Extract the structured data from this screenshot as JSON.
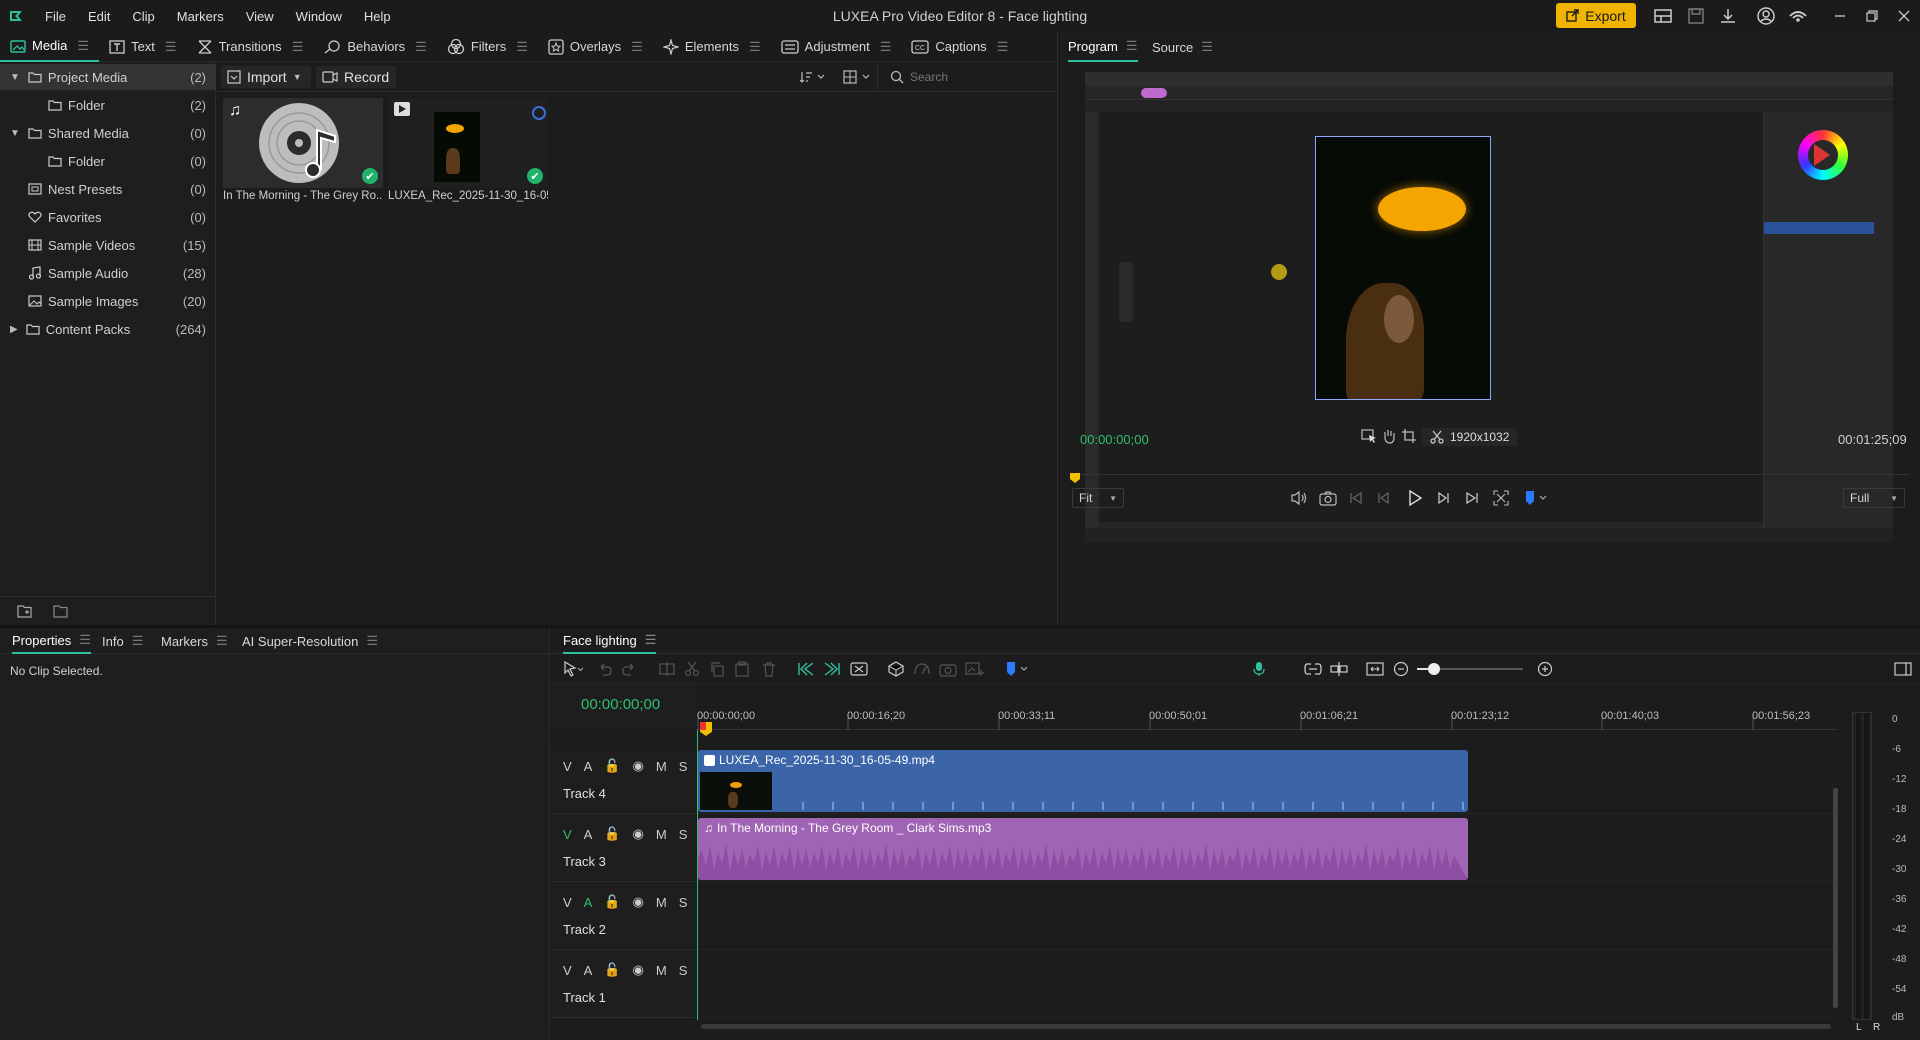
{
  "app": {
    "title": "LUXEA Pro Video Editor 8 - Face lighting",
    "menu": [
      "File",
      "Edit",
      "Clip",
      "Markers",
      "View",
      "Window",
      "Help"
    ],
    "export_label": "Export"
  },
  "tooltabs": [
    {
      "label": "Media",
      "icon": "media-icon"
    },
    {
      "label": "Text",
      "icon": "text-icon"
    },
    {
      "label": "Transitions",
      "icon": "transitions-icon"
    },
    {
      "label": "Behaviors",
      "icon": "behaviors-icon"
    },
    {
      "label": "Filters",
      "icon": "filters-icon"
    },
    {
      "label": "Overlays",
      "icon": "overlays-icon"
    },
    {
      "label": "Elements",
      "icon": "elements-icon"
    },
    {
      "label": "Adjustment",
      "icon": "adjustment-icon"
    },
    {
      "label": "Captions",
      "icon": "captions-icon"
    }
  ],
  "media_tree": [
    {
      "label": "Project Media",
      "count": "(2)"
    },
    {
      "label": "Folder",
      "count": "(2)"
    },
    {
      "label": "Shared Media",
      "count": "(0)"
    },
    {
      "label": "Folder",
      "count": "(0)"
    },
    {
      "label": "Nest Presets",
      "count": "(0)"
    },
    {
      "label": "Favorites",
      "count": "(0)"
    },
    {
      "label": "Sample Videos",
      "count": "(15)"
    },
    {
      "label": "Sample Audio",
      "count": "(28)"
    },
    {
      "label": "Sample Images",
      "count": "(20)"
    },
    {
      "label": "Content Packs",
      "count": "(264)"
    }
  ],
  "bin": {
    "import_label": "Import",
    "record_label": "Record",
    "search_placeholder": "Search",
    "items": [
      {
        "label": "In The Morning - The Grey Ro..."
      },
      {
        "label": "LUXEA_Rec_2025-11-30_16-05..."
      }
    ]
  },
  "program": {
    "tabs": [
      "Program",
      "Source"
    ],
    "current_tc": "00:00:00;00",
    "duration_tc": "00:01:25;09",
    "resolution": "1920x1032",
    "fit_label": "Fit",
    "quality_label": "Full"
  },
  "properties": {
    "tabs": [
      "Properties",
      "Info",
      "Markers",
      "AI Super-Resolution"
    ],
    "empty_text": "No Clip Selected."
  },
  "timeline": {
    "sequence_name": "Face lighting",
    "timecode": "00:00:00;00",
    "ruler": [
      "00:00:00;00",
      "00:00:16;20",
      "00:00:33;11",
      "00:00:50;01",
      "00:01:06;21",
      "00:01:23;12",
      "00:01:40;03",
      "00:01:56;23"
    ],
    "tracks": [
      {
        "name": "Track 4",
        "v": "V",
        "a": "A",
        "m": "M",
        "s": "S"
      },
      {
        "name": "Track 3",
        "v": "V",
        "a": "A",
        "m": "M",
        "s": "S"
      },
      {
        "name": "Track 2",
        "v": "V",
        "a": "A",
        "m": "M",
        "s": "S"
      },
      {
        "name": "Track 1",
        "v": "V",
        "a": "A",
        "m": "M",
        "s": "S"
      }
    ],
    "video_clip": "LUXEA_Rec_2025-11-30_16-05-49.mp4",
    "audio_clip": "In The Morning - The Grey Room _ Clark Sims.mp3",
    "meter_db": [
      "0",
      "-6",
      "-12",
      "-18",
      "-24",
      "-30",
      "-36",
      "-42",
      "-48",
      "-54",
      "dB"
    ],
    "meter_lr": [
      "L",
      "R"
    ]
  },
  "colors": {
    "accent": "#2fbf9f",
    "export": "#f0b400",
    "video_clip": "#3b65a8",
    "audio_clip": "#a064b4",
    "timecode": "#2fbf6f"
  }
}
